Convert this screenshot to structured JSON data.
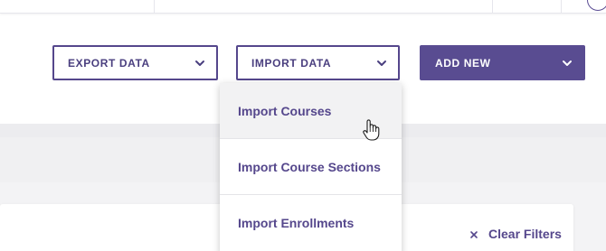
{
  "toolbar": {
    "export_label": "EXPORT DATA",
    "import_label": "IMPORT DATA",
    "add_label": "ADD NEW"
  },
  "import_menu": {
    "items": [
      {
        "label": "Import Courses",
        "hovered": true
      },
      {
        "label": "Import Course Sections",
        "hovered": false
      },
      {
        "label": "Import Enrollments",
        "hovered": false
      }
    ]
  },
  "filters": {
    "clear_label": "Clear Filters"
  },
  "colors": {
    "accent": "#594c91",
    "accent_text": "#4a3f7f",
    "hover_bg": "#f2f2f3",
    "band_bg": "#f0f0f2"
  },
  "icons": {
    "chevron": "chevron-down-icon",
    "clear": "close-icon",
    "cursor": "hand-pointer-icon"
  }
}
